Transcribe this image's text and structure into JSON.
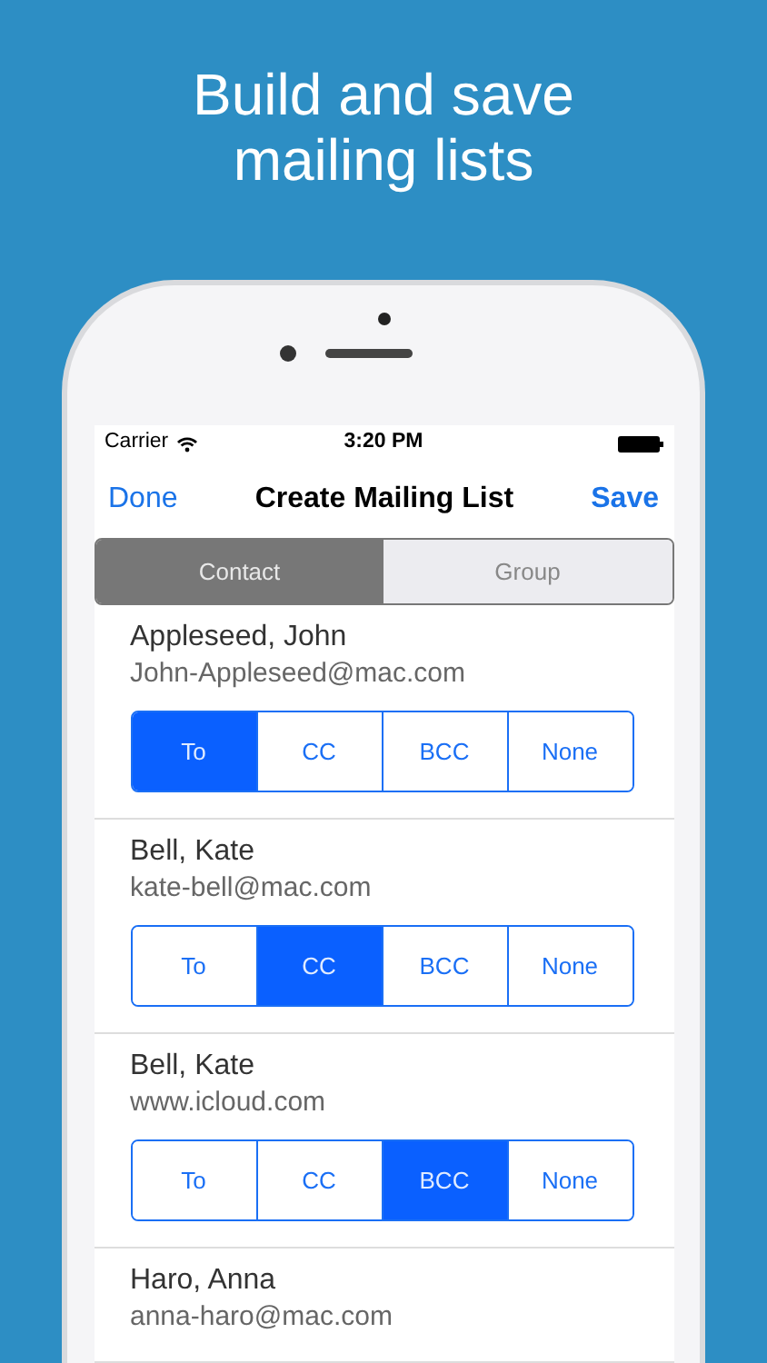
{
  "headline": "Build and save mailing lists",
  "status_bar": {
    "carrier": "Carrier",
    "time": "3:20 PM"
  },
  "nav": {
    "left": "Done",
    "title": "Create Mailing List",
    "right": "Save"
  },
  "tabs": [
    {
      "label": "Contact",
      "selected": true
    },
    {
      "label": "Group",
      "selected": false
    }
  ],
  "contacts": [
    {
      "name": "Appleseed, John",
      "email": "John-Appleseed@mac.com",
      "options": [
        {
          "label": "To",
          "selected": true
        },
        {
          "label": "CC",
          "selected": false
        },
        {
          "label": "BCC",
          "selected": false
        },
        {
          "label": "None",
          "selected": false
        }
      ]
    },
    {
      "name": "Bell, Kate",
      "email": "kate-bell@mac.com",
      "options": [
        {
          "label": "To",
          "selected": false
        },
        {
          "label": "CC",
          "selected": true
        },
        {
          "label": "BCC",
          "selected": false
        },
        {
          "label": "None",
          "selected": false
        }
      ]
    },
    {
      "name": "Bell, Kate",
      "email": "www.icloud.com",
      "options": [
        {
          "label": "To",
          "selected": false
        },
        {
          "label": "CC",
          "selected": false
        },
        {
          "label": "BCC",
          "selected": true
        },
        {
          "label": "None",
          "selected": false
        }
      ]
    },
    {
      "name": "Haro, Anna",
      "email": "anna-haro@mac.com"
    }
  ]
}
